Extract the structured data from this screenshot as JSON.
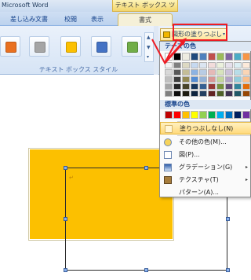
{
  "window": {
    "app_title": "Microsoft Word",
    "context_tool_title": "テキスト ボックス ツール"
  },
  "tabs": {
    "mailings": "差し込み文書",
    "review": "校閲",
    "view": "表示",
    "format": "書式"
  },
  "ribbon": {
    "style_group_label": "テキスト ボックス スタイル",
    "shape_fill_label": "図形の塗りつぶし",
    "style_swatches": [
      "#e9701f",
      "#a5a5a5",
      "#fcc000",
      "#4472c4",
      "#70ad47"
    ],
    "scroll_up": "▲",
    "scroll_down": "▼",
    "scroll_more": "▾",
    "dropdown_arrow": "▾"
  },
  "fill_menu": {
    "theme_colors_header": "テーマの色",
    "standard_colors_header": "標準の色",
    "theme_colors": [
      [
        "#ffffff",
        "#000000",
        "#eeece1",
        "#1f497d",
        "#4f81bd",
        "#c0504d",
        "#9bbb59",
        "#8064a2",
        "#4bacc6",
        "#f79646"
      ],
      [
        "#f2f2f2",
        "#7f7f7f",
        "#ddd9c3",
        "#c6d9f0",
        "#dbe5f1",
        "#f2dcdb",
        "#ebf1dd",
        "#e5e0ec",
        "#dbeef3",
        "#fdeada"
      ],
      [
        "#d8d8d8",
        "#595959",
        "#c4bd97",
        "#8db3e2",
        "#b8cce4",
        "#e5b9b7",
        "#d7e3bc",
        "#ccc1d9",
        "#b7dde8",
        "#fbd5b5"
      ],
      [
        "#bfbfbf",
        "#3f3f3f",
        "#938953",
        "#548dd4",
        "#95b3d7",
        "#d99694",
        "#c3d69b",
        "#b2a2c7",
        "#92cddc",
        "#fac08f"
      ],
      [
        "#a5a5a5",
        "#262626",
        "#494429",
        "#17365d",
        "#366092",
        "#953734",
        "#76923c",
        "#5f497a",
        "#31859b",
        "#e36c09"
      ],
      [
        "#7f7f7f",
        "#0c0c0c",
        "#1d1b10",
        "#0f243e",
        "#244061",
        "#632423",
        "#4f6128",
        "#3f3151",
        "#205867",
        "#974806"
      ]
    ],
    "standard_colors": [
      "#c00000",
      "#ff0000",
      "#ffc000",
      "#ffff00",
      "#92d050",
      "#00b050",
      "#00b0f0",
      "#0070c0",
      "#002060",
      "#7030a0"
    ],
    "no_fill": "塗りつぶしなし(N)",
    "more_colors": "その他の色(M)...",
    "picture": "図(P)...",
    "gradient": "グラデーション(G)",
    "texture": "テクスチャ(T)",
    "pattern": "パターン(A)...",
    "submenu_arrow": "▸"
  },
  "document": {
    "textbox_color": "#fcc000",
    "cursor_mark": "↵"
  }
}
